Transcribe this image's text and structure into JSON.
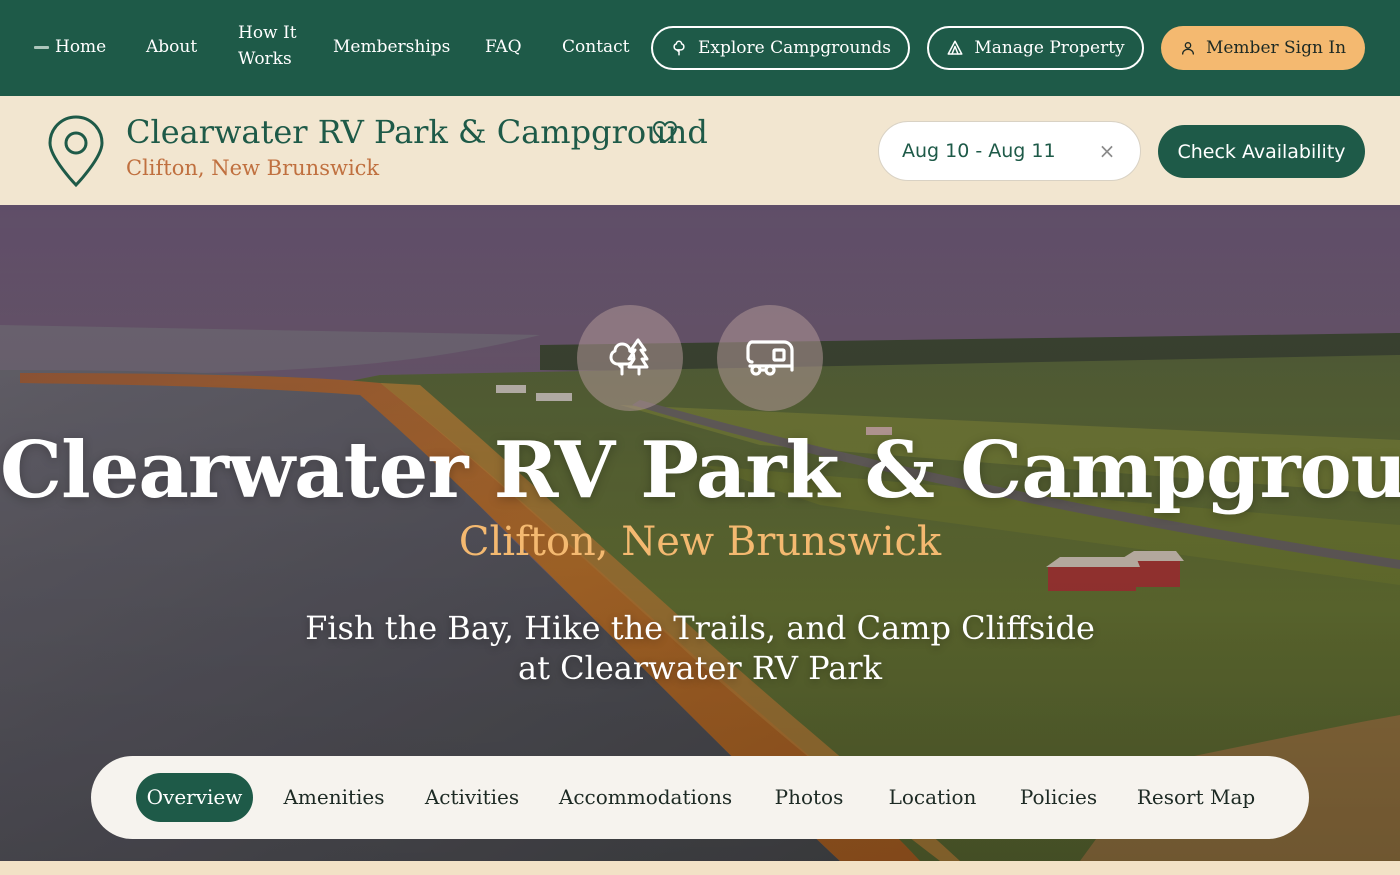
{
  "nav": {
    "home": "Home",
    "about": "About",
    "how_it_works": "How It Works",
    "memberships": "Memberships",
    "faq": "FAQ",
    "contact": "Contact",
    "explore_label": "Explore Campgrounds",
    "manage_label": "Manage Property",
    "signin_label": "Member Sign In"
  },
  "property": {
    "name": "Clearwater RV Park & Campground",
    "location": "Clifton, New Brunswick",
    "date_range": "Aug 10 - Aug 11",
    "check_label": "Check Availability"
  },
  "hero": {
    "title": "Clearwater RV Park & Campground",
    "location": "Clifton, New Brunswick",
    "tagline": "Fish the Bay, Hike the Trails, and Camp Cliffside at Clearwater RV Park"
  },
  "tabs": [
    {
      "label": "Overview",
      "active": true
    },
    {
      "label": "Amenities",
      "active": false
    },
    {
      "label": "Activities",
      "active": false
    },
    {
      "label": "Accommodations",
      "active": false
    },
    {
      "label": "Photos",
      "active": false
    },
    {
      "label": "Location",
      "active": false
    },
    {
      "label": "Policies",
      "active": false
    },
    {
      "label": "Resort Map",
      "active": false
    }
  ],
  "colors": {
    "brand_green": "#1e5a48",
    "accent_orange": "#f4b970",
    "location_text": "#c0703f",
    "cream": "#f2e6d0"
  },
  "icons": [
    "home-mark-icon",
    "tree-icon",
    "tent-icon",
    "user-icon",
    "map-pin-icon",
    "heart-icon",
    "clear-icon",
    "trees-icon",
    "rv-trailer-icon"
  ]
}
